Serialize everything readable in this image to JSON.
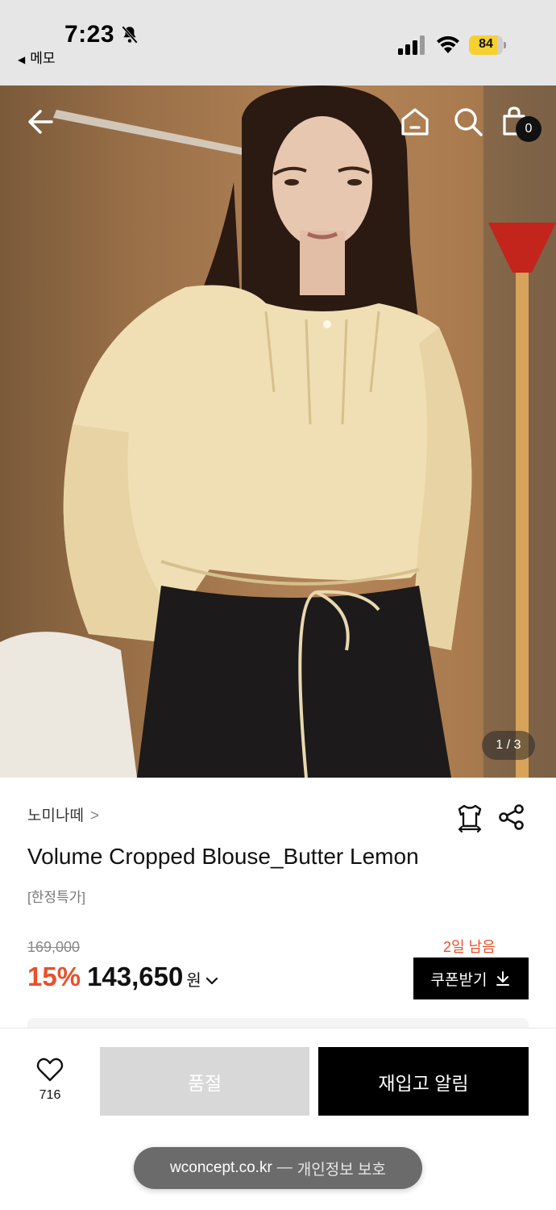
{
  "status_bar": {
    "time": "7:23",
    "back_app": "메모",
    "battery": "84"
  },
  "nav": {
    "bag_count": "0"
  },
  "gallery": {
    "pager": "1 / 3"
  },
  "product": {
    "brand": "노미나떼",
    "title": "Volume Cropped Blouse_Butter Lemon",
    "tag": "[한정특가]",
    "original_price": "169,000",
    "discount": "15%",
    "price": "143,650",
    "currency": "원",
    "coupon_remaining": "2일 남음",
    "coupon_button": "쿠폰받기"
  },
  "actions": {
    "like_count": "716",
    "soldout_label": "품절",
    "restock_label": "재입고 알림"
  },
  "browser": {
    "domain": "wconcept.co.kr",
    "privacy": "개인정보 보호"
  },
  "colors": {
    "accent": "#e8512b",
    "primary_button": "#000000",
    "disabled_button": "#d8d8d8"
  },
  "icons": [
    "bell-slash-icon",
    "signal-icon",
    "wifi-icon",
    "battery-icon",
    "back-arrow-icon",
    "home-icon",
    "search-icon",
    "shopping-bag-icon",
    "fit-icon",
    "share-icon",
    "heart-icon",
    "download-icon",
    "chevron-down-icon",
    "chevron-right-icon"
  ]
}
